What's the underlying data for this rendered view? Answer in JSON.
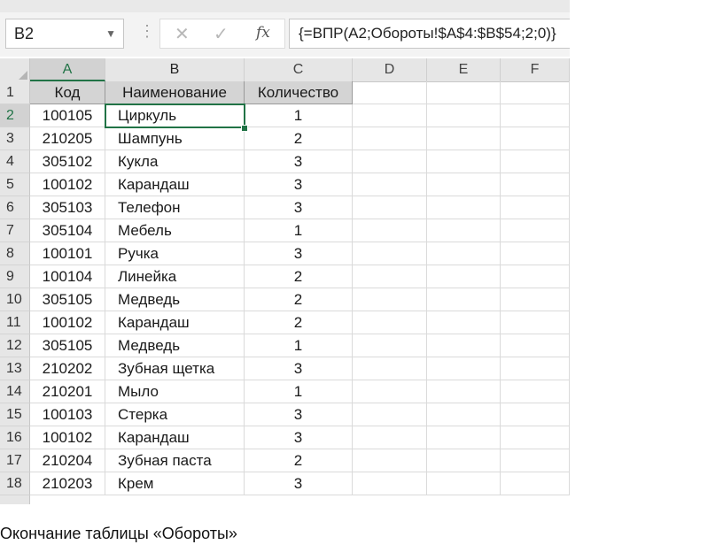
{
  "formula_bar": {
    "name_box": "B2",
    "formula": "{=ВПР(A2;Обороты!$A$4:$B$54;2;0)}",
    "icons": [
      "dropdown-arrow-icon",
      "cancel-x-icon",
      "enter-check-icon",
      "insert-function-icon"
    ]
  },
  "columns": [
    "A",
    "B",
    "C",
    "D",
    "E",
    "F"
  ],
  "selected_column": "A",
  "header_row": {
    "num": "1",
    "a": "Код",
    "b": "Наименование",
    "c": "Количество"
  },
  "rows": [
    {
      "num": "2",
      "a": "100105",
      "b": "Циркуль",
      "c": "1"
    },
    {
      "num": "3",
      "a": "210205",
      "b": "Шампунь",
      "c": "2"
    },
    {
      "num": "4",
      "a": "305102",
      "b": "Кукла",
      "c": "3"
    },
    {
      "num": "5",
      "a": "100102",
      "b": "Карандаш",
      "c": "3"
    },
    {
      "num": "6",
      "a": "305103",
      "b": "Телефон",
      "c": "3"
    },
    {
      "num": "7",
      "a": "305104",
      "b": "Мебель",
      "c": "1"
    },
    {
      "num": "8",
      "a": "100101",
      "b": "Ручка",
      "c": "3"
    },
    {
      "num": "9",
      "a": "100104",
      "b": "Линейка",
      "c": "2"
    },
    {
      "num": "10",
      "a": "305105",
      "b": "Медведь",
      "c": "2"
    },
    {
      "num": "11",
      "a": "100102",
      "b": "Карандаш",
      "c": "2"
    },
    {
      "num": "12",
      "a": "305105",
      "b": "Медведь",
      "c": "1"
    },
    {
      "num": "13",
      "a": "210202",
      "b": "Зубная щетка",
      "c": "3"
    },
    {
      "num": "14",
      "a": "210201",
      "b": "Мыло",
      "c": "1"
    },
    {
      "num": "15",
      "a": "100103",
      "b": "Стерка",
      "c": "3"
    },
    {
      "num": "16",
      "a": "100102",
      "b": "Карандаш",
      "c": "3"
    },
    {
      "num": "17",
      "a": "210204",
      "b": "Зубная паста",
      "c": "2"
    },
    {
      "num": "18",
      "a": "210203",
      "b": "Крем",
      "c": "3"
    }
  ],
  "active_cell": "B2",
  "accent_color": "#217346",
  "caption": "Окончание таблицы «Обороты»"
}
